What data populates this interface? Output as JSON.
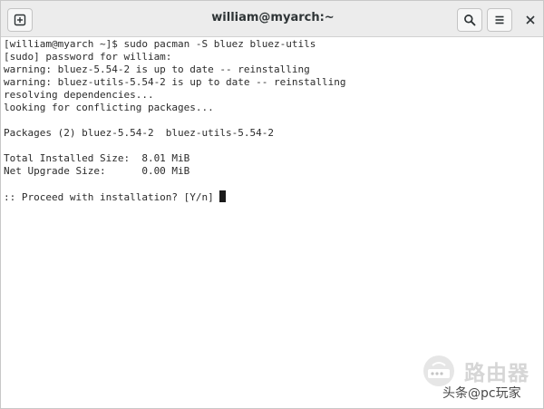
{
  "window": {
    "title": "william@myarch:~"
  },
  "titlebar": {
    "icons": {
      "new_tab": "new-tab-icon",
      "search": "search-icon",
      "menu": "hamburger-menu-icon",
      "close": "close-icon"
    }
  },
  "terminal": {
    "lines": [
      "[william@myarch ~]$ sudo pacman -S bluez bluez-utils",
      "[sudo] password for william:",
      "warning: bluez-5.54-2 is up to date -- reinstalling",
      "warning: bluez-utils-5.54-2 is up to date -- reinstalling",
      "resolving dependencies...",
      "looking for conflicting packages...",
      "",
      "Packages (2) bluez-5.54-2  bluez-utils-5.54-2",
      "",
      "Total Installed Size:  8.01 MiB",
      "Net Upgrade Size:      0.00 MiB",
      "",
      ":: Proceed with installation? [Y/n] "
    ]
  },
  "watermark": {
    "brand": "路由器",
    "account": "头条@pc玩家"
  },
  "colors": {
    "titlebar_bg": "#ececec",
    "terminal_bg": "#ffffff",
    "terminal_fg": "#2b2b2b"
  }
}
